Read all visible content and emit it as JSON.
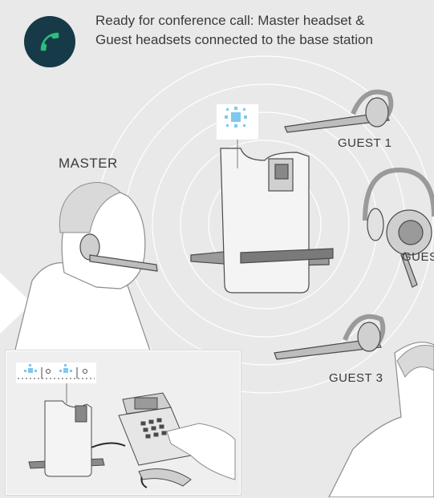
{
  "title": {
    "line1": "Ready for conference call: Master headset &",
    "line2": "Guest headsets connected to the base station"
  },
  "labels": {
    "master": "MASTER",
    "guest1": "GUEST 1",
    "guest2": "GUES",
    "guest3": "GUEST 3"
  },
  "icons": {
    "call": "phone-handset-icon",
    "led": "blue-led-icon"
  },
  "colors": {
    "badge": "#173a48",
    "call_green": "#2bbf7a",
    "led_blue": "#7fc8ee",
    "background": "#e9e9e9"
  }
}
